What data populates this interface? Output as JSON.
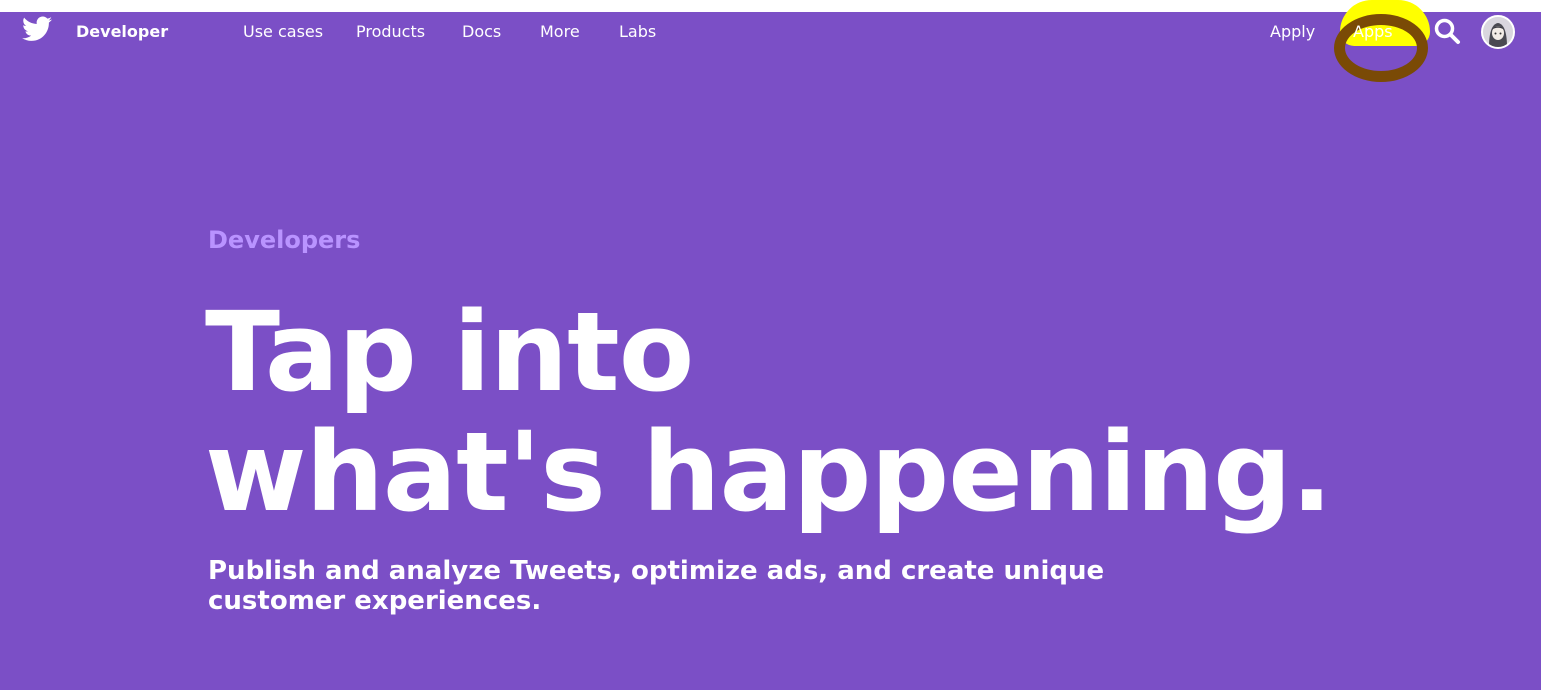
{
  "colors": {
    "hero_background": "#7b4fc6",
    "eyebrow_text": "#b993ff",
    "highlight_yellow": "#ffff00",
    "highlight_ring": "#7a4a06"
  },
  "header": {
    "logo_icon": "twitter-bird-icon",
    "brand": "Developer",
    "nav_left": [
      "Use cases",
      "Products",
      "Docs",
      "More",
      "Labs"
    ],
    "nav_right": [
      "Apply",
      "Apps"
    ],
    "search_icon": "search-icon",
    "avatar_icon": "user-avatar"
  },
  "hero": {
    "eyebrow": "Developers",
    "headline_line1": "Tap into",
    "headline_line2": "what's happening.",
    "subtext": "Publish and analyze Tweets, optimize ads, and create unique customer experiences."
  }
}
